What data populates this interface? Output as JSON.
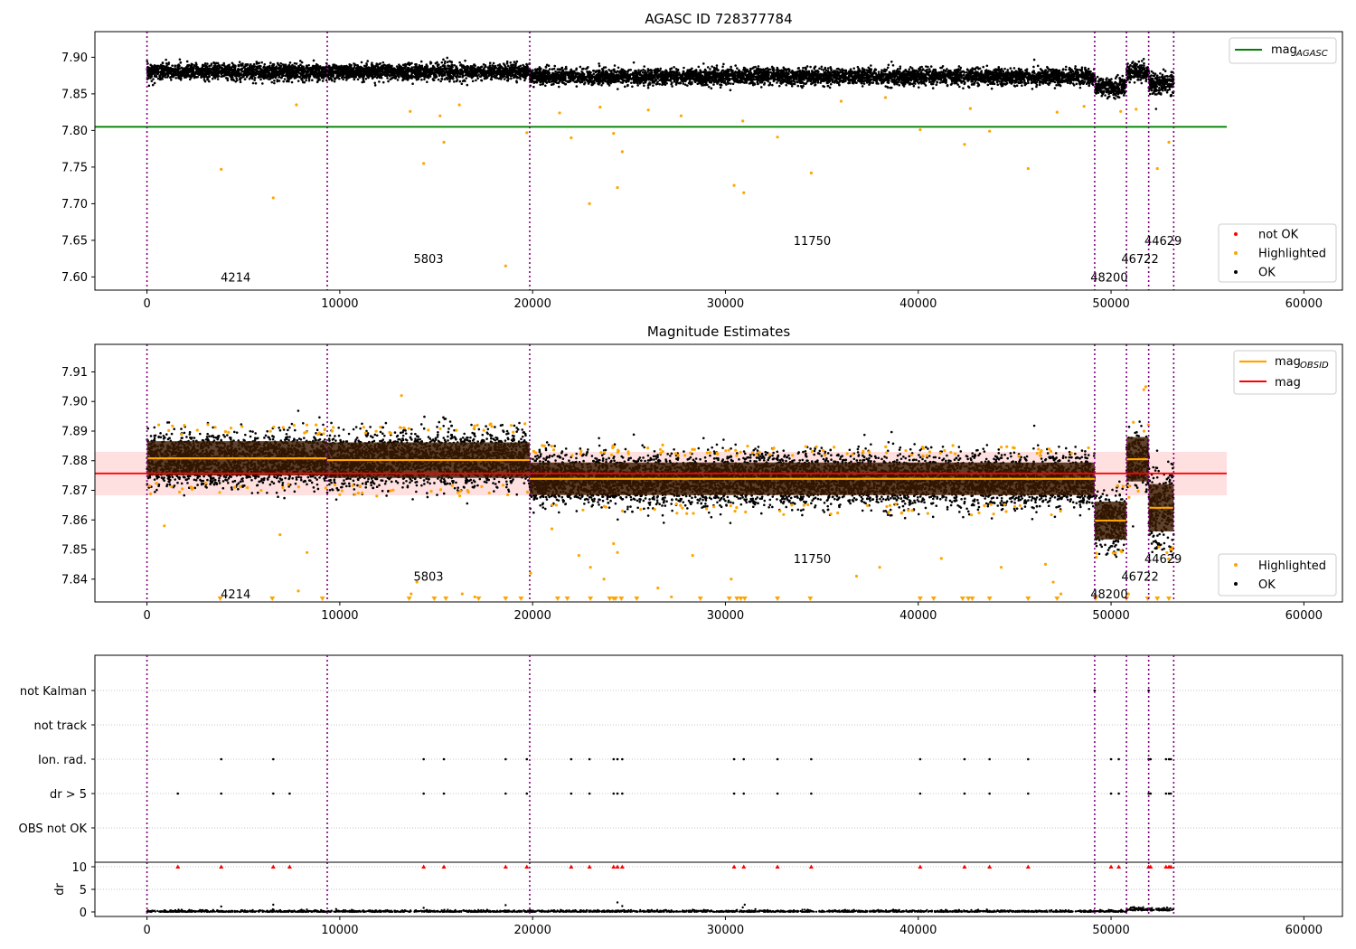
{
  "chart_data": [
    {
      "panel": "top",
      "type": "scatter",
      "title": "AGASC ID 728377784",
      "xlim": [
        -2700,
        62000
      ],
      "ylim": [
        7.582,
        7.935
      ],
      "xticks": [
        0,
        10000,
        20000,
        30000,
        40000,
        50000,
        60000
      ],
      "yticks": [
        7.6,
        7.65,
        7.7,
        7.75,
        7.8,
        7.85,
        7.9
      ],
      "grid": false,
      "obs_boundaries": [
        0,
        9350,
        19850,
        49150,
        50800,
        51950,
        53250
      ],
      "obs_labels": [
        {
          "text": "4214",
          "x": 4600,
          "y": 7.6
        },
        {
          "text": "5803",
          "x": 14600,
          "y": 7.625
        },
        {
          "text": "11750",
          "x": 34500,
          "y": 7.65
        },
        {
          "text": "48200",
          "x": 49900,
          "y": 7.6
        },
        {
          "text": "46722",
          "x": 51500,
          "y": 7.625
        },
        {
          "text": "44629",
          "x": 52700,
          "y": 7.65
        }
      ],
      "series": [
        {
          "name": "mag",
          "name_sub": "AGASC",
          "kind": "line",
          "color": "#008000",
          "y": 7.805,
          "x_range": [
            -2700,
            56000
          ]
        },
        {
          "name": "not OK",
          "kind": "points",
          "color": "#ff0000",
          "points": []
        },
        {
          "name": "Highlighted",
          "kind": "points",
          "color": "#ffa500",
          "points": [
            [
              3850,
              7.747
            ],
            [
              6550,
              7.708
            ],
            [
              14350,
              7.755
            ],
            [
              15400,
              7.784
            ],
            [
              18600,
              7.615
            ],
            [
              19700,
              7.797
            ],
            [
              22000,
              7.79
            ],
            [
              22950,
              7.7
            ],
            [
              24200,
              7.796
            ],
            [
              24400,
              7.722
            ],
            [
              24650,
              7.771
            ],
            [
              30450,
              7.725
            ],
            [
              30950,
              7.715
            ],
            [
              32700,
              7.791
            ],
            [
              34450,
              7.742
            ],
            [
              40100,
              7.801
            ],
            [
              42400,
              7.781
            ],
            [
              43700,
              7.799
            ],
            [
              45700,
              7.748
            ],
            [
              52400,
              7.748
            ],
            [
              53000,
              7.784
            ],
            [
              7750,
              7.835
            ],
            [
              13650,
              7.826
            ],
            [
              15200,
              7.82
            ],
            [
              16200,
              7.835
            ],
            [
              21400,
              7.824
            ],
            [
              23500,
              7.832
            ],
            [
              26000,
              7.828
            ],
            [
              27700,
              7.82
            ],
            [
              30900,
              7.813
            ],
            [
              36000,
              7.84
            ],
            [
              38300,
              7.845
            ],
            [
              42700,
              7.83
            ],
            [
              47200,
              7.825
            ],
            [
              48600,
              7.833
            ],
            [
              50500,
              7.826
            ],
            [
              51300,
              7.829
            ]
          ]
        },
        {
          "name": "OK",
          "kind": "points",
          "color": "#000000",
          "points": []
        }
      ],
      "bands": [
        {
          "x": [
            0,
            9350
          ],
          "center": 7.88,
          "spread": 0.012,
          "color": "#000000"
        },
        {
          "x": [
            9350,
            19850
          ],
          "center": 7.88,
          "spread": 0.012,
          "color": "#000000"
        },
        {
          "x": [
            19850,
            49150
          ],
          "center": 7.8735,
          "spread": 0.012,
          "color": "#000000"
        },
        {
          "x": [
            49150,
            50800
          ],
          "center": 7.8595,
          "spread": 0.014,
          "color": "#000000"
        },
        {
          "x": [
            50800,
            51950
          ],
          "center": 7.8805,
          "spread": 0.013,
          "color": "#000000"
        },
        {
          "x": [
            51950,
            53250
          ],
          "center": 7.864,
          "spread": 0.016,
          "color": "#000000"
        }
      ],
      "legend_lines": {
        "location": "upper right"
      },
      "legend_points": {
        "location": "lower right"
      }
    },
    {
      "panel": "middle",
      "type": "scatter",
      "title": "Magnitude Estimates",
      "xlim": [
        -2700,
        62000
      ],
      "ylim": [
        7.8323,
        7.9193
      ],
      "xticks": [
        0,
        10000,
        20000,
        30000,
        40000,
        50000,
        60000
      ],
      "yticks": [
        7.84,
        7.85,
        7.86,
        7.87,
        7.88,
        7.89,
        7.9,
        7.91
      ],
      "grid": false,
      "obs_boundaries": [
        0,
        9350,
        19850,
        49150,
        50800,
        51950,
        53250
      ],
      "obs_labels": [
        {
          "text": "4214",
          "x": 4600,
          "y": 7.835
        },
        {
          "text": "5803",
          "x": 14600,
          "y": 7.841
        },
        {
          "text": "11750",
          "x": 34500,
          "y": 7.847
        },
        {
          "text": "48200",
          "x": 49900,
          "y": 7.835
        },
        {
          "text": "46722",
          "x": 51500,
          "y": 7.841
        },
        {
          "text": "44629",
          "x": 52700,
          "y": 7.847
        }
      ],
      "mag_line": {
        "name": "mag",
        "color": "#ff0000",
        "y": 7.8757,
        "band": [
          7.8683,
          7.883
        ],
        "x_range": [
          -2700,
          56000
        ]
      },
      "obsid_means": [
        {
          "x": [
            0,
            9350
          ],
          "y": 7.8808,
          "half_band": 0.0058
        },
        {
          "x": [
            9350,
            19850
          ],
          "y": 7.8802,
          "half_band": 0.006
        },
        {
          "x": [
            19850,
            49150
          ],
          "y": 7.8739,
          "half_band": 0.0055
        },
        {
          "x": [
            49150,
            50800
          ],
          "y": 7.8598,
          "half_band": 0.0064
        },
        {
          "x": [
            50800,
            51950
          ],
          "y": 7.8805,
          "half_band": 0.0075
        },
        {
          "x": [
            51950,
            53250
          ],
          "y": 7.8641,
          "half_band": 0.008
        }
      ],
      "series": [
        {
          "name": "mag",
          "name_sub": "OBSID",
          "kind": "line",
          "color": "#ffa500"
        },
        {
          "name": "mag",
          "kind": "line",
          "color": "#ff0000"
        },
        {
          "name": "Highlighted",
          "kind": "points",
          "color": "#ffa500",
          "points": [
            [
              7850,
              7.836
            ],
            [
              8300,
              7.849
            ],
            [
              6900,
              7.855
            ],
            [
              13700,
              7.835
            ],
            [
              14000,
              7.839
            ],
            [
              16350,
              7.835
            ],
            [
              17000,
              7.834
            ],
            [
              19900,
              7.842
            ],
            [
              21000,
              7.857
            ],
            [
              22400,
              7.848
            ],
            [
              23000,
              7.844
            ],
            [
              23700,
              7.84
            ],
            [
              24200,
              7.852
            ],
            [
              24400,
              7.849
            ],
            [
              26500,
              7.837
            ],
            [
              27200,
              7.834
            ],
            [
              28300,
              7.848
            ],
            [
              30300,
              7.84
            ],
            [
              36800,
              7.841
            ],
            [
              38000,
              7.844
            ],
            [
              41200,
              7.847
            ],
            [
              44300,
              7.844
            ],
            [
              46600,
              7.845
            ],
            [
              47000,
              7.839
            ],
            [
              47400,
              7.835
            ],
            [
              13200,
              7.902
            ],
            [
              50900,
              7.835
            ],
            [
              51800,
              7.905
            ],
            [
              51700,
              7.904
            ],
            [
              900,
              7.858
            ]
          ]
        },
        {
          "name": "OK",
          "kind": "points",
          "color": "#000000",
          "points": []
        }
      ],
      "clipped_markers_x": [
        3800,
        6500,
        9100,
        13600,
        14900,
        15500,
        17200,
        18600,
        19400,
        21300,
        21800,
        23000,
        24000,
        24200,
        24300,
        24600,
        25400,
        28700,
        30200,
        30600,
        30800,
        31000,
        32700,
        34400,
        40100,
        40800,
        42300,
        42600,
        42800,
        43700,
        45700,
        47200,
        49200,
        50800,
        51900,
        52400,
        53000
      ],
      "bands": [
        {
          "x": [
            0,
            9350
          ],
          "center": 7.8805,
          "spread": 0.0095,
          "color": "#000000"
        },
        {
          "x": [
            9350,
            19850
          ],
          "center": 7.8805,
          "spread": 0.01,
          "color": "#000000"
        },
        {
          "x": [
            19850,
            49150
          ],
          "center": 7.8735,
          "spread": 0.0095,
          "color": "#000000"
        },
        {
          "x": [
            49150,
            50800
          ],
          "center": 7.8598,
          "spread": 0.01,
          "color": "#000000"
        },
        {
          "x": [
            50800,
            51950
          ],
          "center": 7.8805,
          "spread": 0.0105,
          "color": "#000000"
        },
        {
          "x": [
            51950,
            53250
          ],
          "center": 7.8641,
          "spread": 0.015,
          "color": "#000000"
        }
      ],
      "legend_lines": {
        "location": "upper right"
      },
      "legend_points": {
        "location": "lower right"
      }
    },
    {
      "panel": "flags",
      "type": "scatter",
      "xlim": [
        -2700,
        62000
      ],
      "categories": [
        "not Kalman",
        "not track",
        "Ion. rad.",
        "dr > 5",
        "OBS not OK"
      ],
      "grid": true,
      "obs_boundaries": [
        0,
        9350,
        19850,
        49150,
        50800,
        51950,
        53250
      ],
      "flags": [
        {
          "category": "not Kalman",
          "x": [
            49150,
            51950
          ]
        },
        {
          "category": "not track",
          "x": []
        },
        {
          "category": "Ion. rad.",
          "x": [
            3850,
            6550,
            14350,
            15400,
            18600,
            19700,
            22000,
            22950,
            24200,
            24400,
            24650,
            30450,
            30950,
            32700,
            34450,
            40100,
            42400,
            43700,
            45700,
            50000,
            50400,
            51950,
            52050,
            52850,
            53000,
            53100
          ]
        },
        {
          "category": "dr > 5",
          "x": [
            1600,
            3850,
            6550,
            7400,
            14350,
            15400,
            18600,
            19700,
            22000,
            22950,
            24200,
            24400,
            24650,
            30450,
            30950,
            32700,
            34450,
            40100,
            42400,
            43700,
            45700,
            50000,
            50400,
            51950,
            52050,
            52850,
            53000,
            53100
          ]
        },
        {
          "category": "OBS not OK",
          "x": []
        }
      ]
    },
    {
      "panel": "dr",
      "type": "scatter",
      "ylabel": "dr",
      "xlim": [
        -2700,
        62000
      ],
      "ylim": [
        -1,
        11
      ],
      "xticks": [
        0,
        10000,
        20000,
        30000,
        40000,
        50000,
        60000
      ],
      "yticks": [
        0,
        5,
        10
      ],
      "grid": true,
      "obs_boundaries": [
        0,
        9350,
        19850,
        49150,
        50800,
        51950,
        53250
      ],
      "clipped_markers_x": [
        1600,
        3850,
        6550,
        7400,
        14350,
        15400,
        18600,
        19700,
        22000,
        22950,
        24200,
        24400,
        24650,
        30450,
        30950,
        32700,
        34450,
        40100,
        42400,
        43700,
        45700,
        50000,
        50400,
        51950,
        52050,
        52850,
        53000,
        53100
      ],
      "outlier_points": [
        [
          3850,
          1.2
        ],
        [
          6550,
          1.6
        ],
        [
          18600,
          1.5
        ],
        [
          24400,
          2.1
        ],
        [
          24650,
          1.3
        ],
        [
          30900,
          1.0
        ],
        [
          31000,
          1.6
        ],
        [
          14350,
          0.9
        ]
      ]
    }
  ]
}
